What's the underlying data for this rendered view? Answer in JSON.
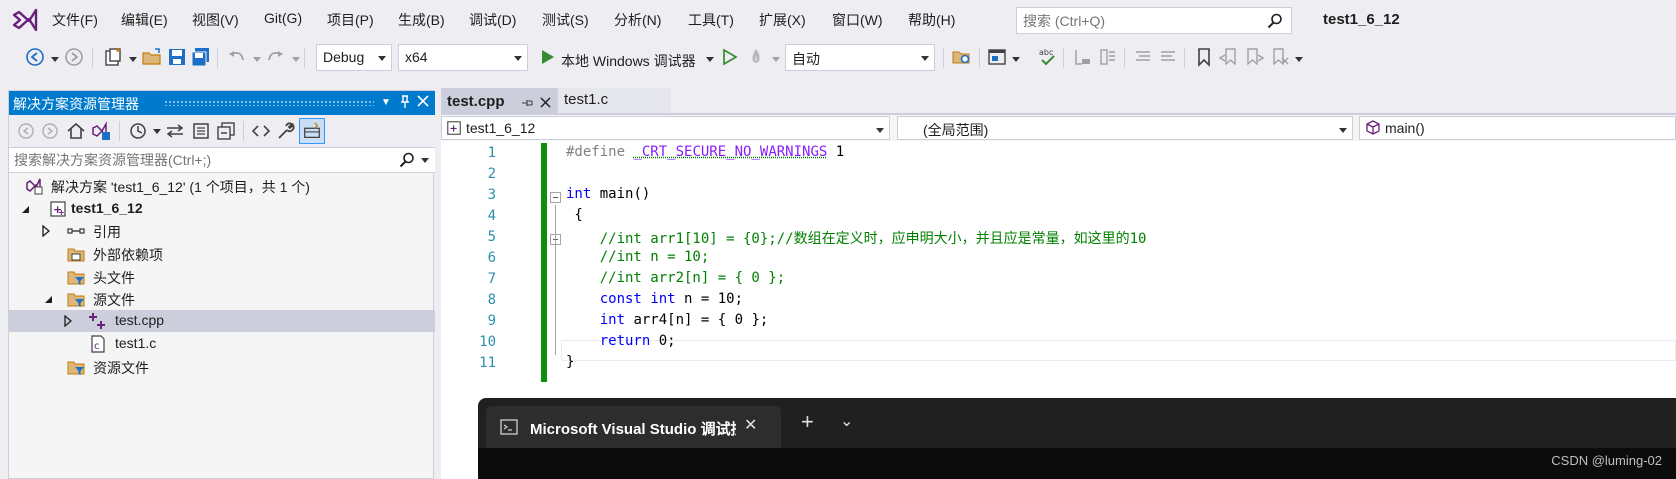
{
  "menu": {
    "items": [
      "文件(F)",
      "编辑(E)",
      "视图(V)",
      "Git(G)",
      "项目(P)",
      "生成(B)",
      "调试(D)",
      "测试(S)",
      "分析(N)",
      "工具(T)",
      "扩展(X)",
      "窗口(W)",
      "帮助(H)"
    ],
    "search_placeholder": "搜索 (Ctrl+Q)",
    "solution_name": "test1_6_12"
  },
  "toolbar": {
    "configuration": "Debug",
    "platform": "x64",
    "run_label": "本地 Windows 调试器",
    "target": "自动"
  },
  "solution_explorer": {
    "title": "解决方案资源管理器",
    "search_placeholder": "搜索解决方案资源管理器(Ctrl+;)",
    "tree": [
      {
        "label": "解决方案 'test1_6_12' (1 个项目，共 1 个)",
        "depth": 0,
        "expanded": null,
        "icon": "solution-icon"
      },
      {
        "label": "test1_6_12",
        "depth": 0,
        "expanded": true,
        "icon": "project-icon",
        "bold": true
      },
      {
        "label": "引用",
        "depth": 1,
        "expanded": false,
        "icon": "references-icon"
      },
      {
        "label": "外部依赖项",
        "depth": 1,
        "expanded": null,
        "icon": "external-deps-icon"
      },
      {
        "label": "头文件",
        "depth": 1,
        "expanded": null,
        "icon": "filter-folder-icon"
      },
      {
        "label": "源文件",
        "depth": 1,
        "expanded": true,
        "icon": "filter-folder-icon"
      },
      {
        "label": "test.cpp",
        "depth": 2,
        "expanded": false,
        "icon": "cpp-file-icon",
        "selected": true
      },
      {
        "label": "test1.c",
        "depth": 2,
        "expanded": null,
        "icon": "c-file-icon"
      },
      {
        "label": "资源文件",
        "depth": 1,
        "expanded": null,
        "icon": "filter-folder-icon"
      }
    ]
  },
  "editor": {
    "tabs": [
      {
        "label": "test.cpp",
        "active": true
      },
      {
        "label": "test1.c",
        "active": false
      }
    ],
    "nav": {
      "project": "test1_6_12",
      "scope": "(全局范围)",
      "member": "main()"
    },
    "lines": [
      "1",
      "2",
      "3",
      "4",
      "5",
      "6",
      "7",
      "8",
      "9",
      "10",
      "11"
    ],
    "code": {
      "l1_directive": "#define",
      "l1_macro": "_CRT_SECURE_NO_WARNINGS",
      "l1_value": " 1",
      "l3_kw": "int",
      "l3_rest": " main()",
      "l4": " {",
      "l5": "    //int arr1[10] = {0};//数组在定义时，应申明大小，并且应是常量，如这里的10",
      "l6": "    //int n = 10;",
      "l7": "    //int arr2[n] = { 0 };",
      "l8_kw1": "const",
      "l8_kw2": "int",
      "l8_rest": " n = 10;",
      "l9_kw": "int",
      "l9_rest": " arr4[n] = { 0 };",
      "l10_kw": "return",
      "l10_rest": " 0;",
      "l11": "}"
    }
  },
  "terminal": {
    "tab_title": "Microsoft Visual Studio 调试控制台",
    "new_tab": "+",
    "dropdown": "⌄",
    "close": "✕"
  },
  "watermark": "CSDN @luming-02"
}
